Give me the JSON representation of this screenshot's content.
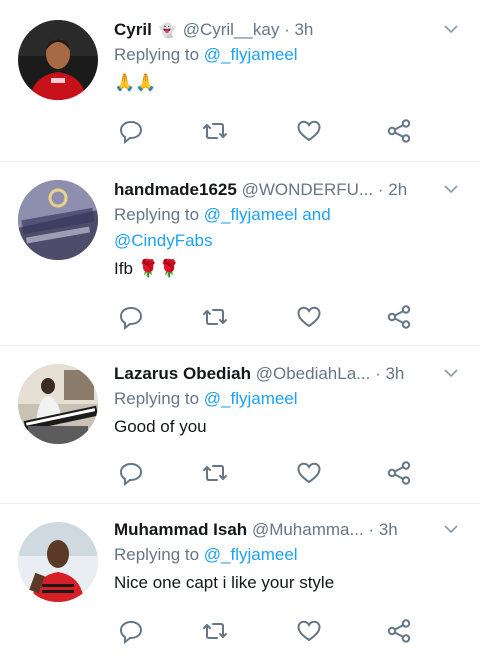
{
  "tweets": [
    {
      "name": "Cyril",
      "name_emoji": "👻",
      "handle": "@Cyril__kay",
      "dot": "·",
      "time": "3h",
      "replying_prefix": "Replying to ",
      "mentions": "@_flyjameel",
      "mentions_2": "",
      "text": "",
      "text_emoji": "🙏🙏",
      "avatar": "red-jersey-man-avatar"
    },
    {
      "name": "handmade1625",
      "handle": "@WONDERFU...",
      "dot": "·",
      "time": "2h",
      "replying_prefix": "Replying to ",
      "mentions": "@_flyjameel and",
      "mentions_2": "@CindyFabs",
      "text": "Ifb",
      "text_emoji": "🌹🌹",
      "avatar": "best-shoes-logo-avatar"
    },
    {
      "name": "Lazarus Obediah",
      "handle": "@ObediahLa...",
      "dot": "·",
      "time": "3h",
      "replying_prefix": "Replying to ",
      "mentions": "@_flyjameel",
      "mentions_2": "",
      "text": "Good of you",
      "text_emoji": "",
      "avatar": "keyboard-player-avatar"
    },
    {
      "name": "Muhammad Isah",
      "handle": "@Muhamma...",
      "dot": "·",
      "time": "3h",
      "replying_prefix": "Replying to ",
      "mentions": "@_flyjameel",
      "mentions_2": "",
      "text": "Nice one capt i like your style",
      "text_emoji": "",
      "avatar": "man-red-shirt-avatar"
    }
  ],
  "colors": {
    "link": "#1da1f2",
    "secondary": "#657786",
    "icon": "#657786",
    "divider": "#e6ecf0"
  },
  "icons": [
    "reply-icon",
    "retweet-icon",
    "like-icon",
    "share-icon",
    "chevron-down-icon"
  ]
}
